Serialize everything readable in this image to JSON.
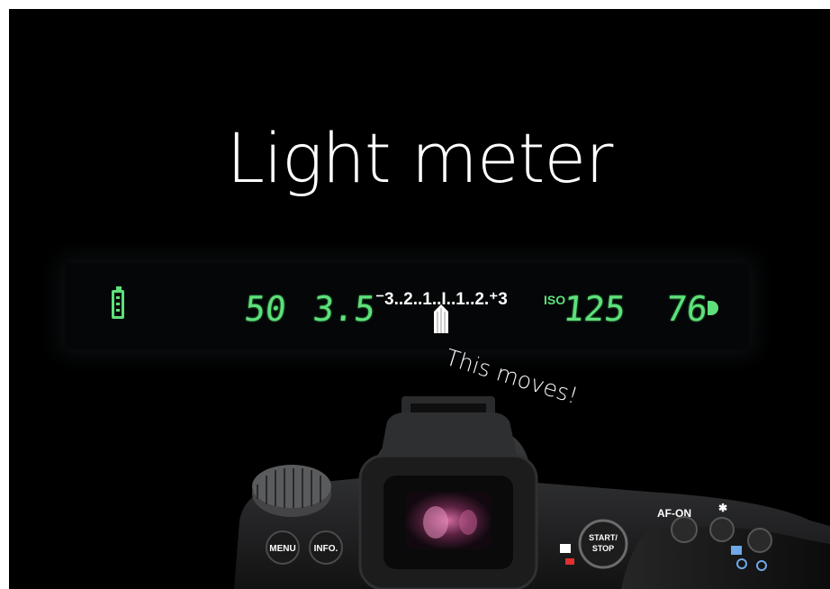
{
  "slide": {
    "title": "Light meter",
    "annotation": "This moves!"
  },
  "viewfinder": {
    "shutter_speed": "50",
    "aperture": "3.5",
    "exposure_scale": "⁻3..2..1..I..1..2.⁺3",
    "iso_label": "ISO",
    "iso_value": "125",
    "shots_remaining": "76",
    "display_color": "#5ee07a"
  },
  "camera": {
    "menu_label": "MENU",
    "info_label": "INFO.",
    "start_stop_label_1": "START/",
    "start_stop_label_2": "STOP",
    "af_on_label": "AF-ON",
    "star_label": "✱"
  }
}
